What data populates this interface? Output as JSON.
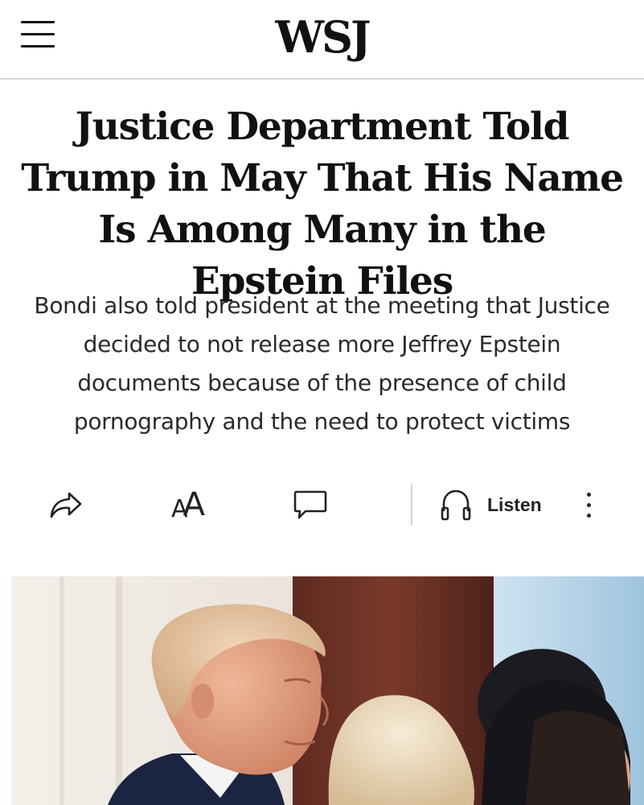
{
  "header": {
    "logo": "WSJ",
    "menu_icon": "hamburger-menu-icon"
  },
  "article": {
    "headline": "Justice Department Told Trump in May That His Name Is Among Many in the Epstein Files",
    "dek": "Bondi also told president at the meeting that Justice decided to not release more Jeffrey Epstein documents because of the presence of child pornography and the need to protect victims"
  },
  "toolbar": {
    "share_icon": "share-icon",
    "text_size_icon": "text-size-icon",
    "text_size_glyph_large": "A",
    "text_size_glyph_small": "A",
    "comment_icon": "comment-icon",
    "listen_icon": "headphones-icon",
    "listen_label": "Listen",
    "more_icon": "more-vertical-icon"
  },
  "photo": {
    "subject": "lead-photo"
  }
}
